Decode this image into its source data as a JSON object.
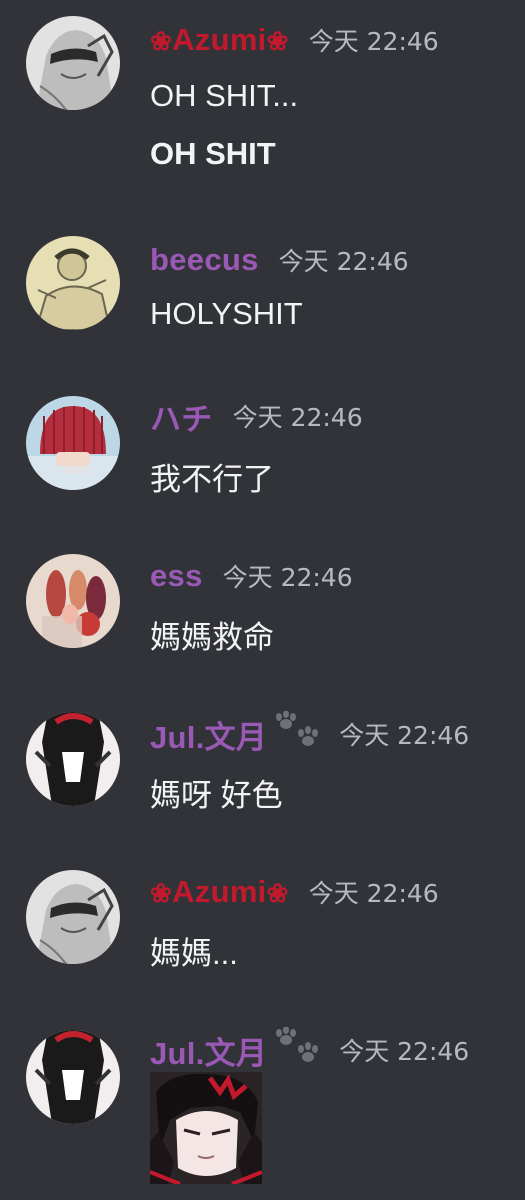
{
  "colors": {
    "background": "#313338",
    "azumi_name": "#c21a2c",
    "role_purple": "#9b59b6",
    "timestamp": "#b5bac1",
    "text": "#f2f3f5"
  },
  "messages": [
    {
      "author": "Azumi",
      "author_prefix": "❀",
      "author_suffix": "❀",
      "timestamp": "今天 22:46",
      "lines": [
        "OH SHIT...",
        "OH SHIT"
      ]
    },
    {
      "author": "beecus",
      "timestamp": "今天 22:46",
      "lines": [
        "HOLYSHIT"
      ]
    },
    {
      "author": "ハチ",
      "timestamp": "今天 22:46",
      "lines": [
        "我不行了"
      ]
    },
    {
      "author": "ess",
      "timestamp": "今天 22:46",
      "lines": [
        "媽媽救命"
      ]
    },
    {
      "author": "Jul.文月",
      "author_badge_icon": "paw-prints-icon",
      "timestamp": "今天 22:46",
      "lines": [
        "媽呀 好色"
      ]
    },
    {
      "author": "Azumi",
      "author_prefix": "❀",
      "author_suffix": "❀",
      "timestamp": "今天 22:46",
      "lines": [
        "媽媽..."
      ]
    },
    {
      "author": "Jul.文月",
      "author_badge_icon": "paw-prints-icon",
      "timestamp": "今天 22:46",
      "attachment_icon": "anime-character-sticker"
    }
  ]
}
